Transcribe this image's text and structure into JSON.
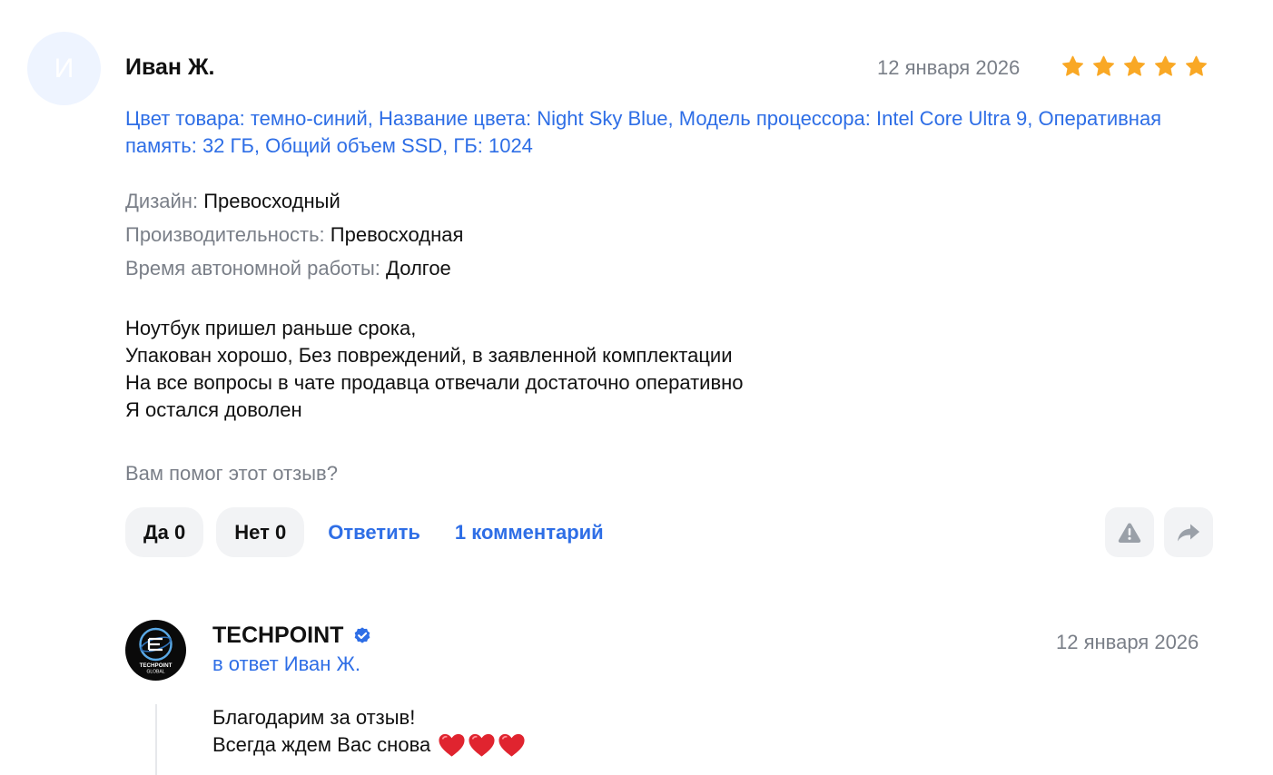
{
  "review": {
    "avatar_letter": "И",
    "author": "Иван Ж.",
    "date": "12 января 2026",
    "rating": 5,
    "product_info": "Цвет товара: темно-синий, Название цвета: Night Sky Blue, Модель процессора: Intel Core Ultra 9, Оперативная память: 32 ГБ, Общий объем SSD, ГБ: 1024",
    "attributes": [
      {
        "key": "Дизайн:",
        "value": "Превосходный"
      },
      {
        "key": "Производительность:",
        "value": "Превосходная"
      },
      {
        "key": "Время автономной работы:",
        "value": "Долгое"
      }
    ],
    "text_lines": [
      "Ноутбук пришел раньше срока,",
      "Упакован хорошо, Без повреждений, в заявленной комплектации",
      "На все вопросы в чате продавца отвечали достаточно оперативно",
      "Я остался доволен"
    ],
    "helpful_question": "Вам помог этот отзыв?",
    "yes_label": "Да 0",
    "no_label": "Нет 0",
    "reply_label": "Ответить",
    "comments_label": "1 комментарий"
  },
  "seller_reply": {
    "logo_text": "TECHPOINT GLOBAL",
    "name": "TECHPOINT",
    "in_reply_to": "в ответ Иван Ж.",
    "date": "12 января 2026",
    "text_lines": [
      "Благодарим за отзыв!",
      "Всегда ждем Вас снова"
    ],
    "emoji": "❤️❤️❤️"
  },
  "icons": {
    "star": "star-icon",
    "warning": "warning-icon",
    "share": "share-icon",
    "verified": "verified-icon",
    "heart": "heart-icon"
  },
  "colors": {
    "accent": "#2e6ee6",
    "star": "#f9a825",
    "muted": "#7a7f88",
    "button_bg": "#f2f3f5",
    "heart": "#e0242f"
  }
}
